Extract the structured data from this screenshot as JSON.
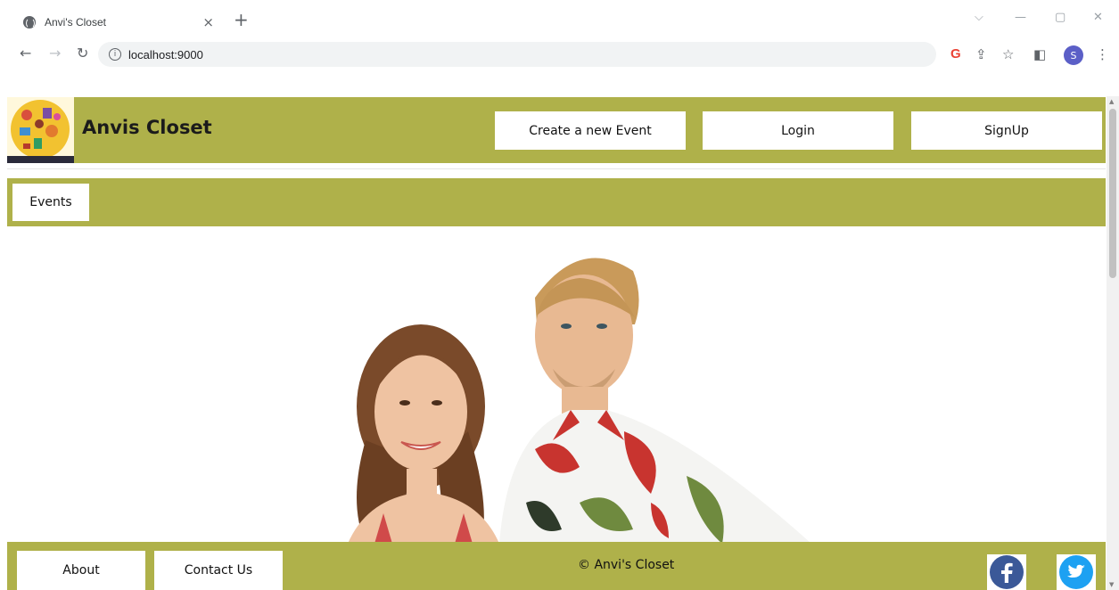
{
  "browser": {
    "tab_title": "Anvi's Closet",
    "tab_close": "×",
    "new_tab": "+",
    "url": "localhost:9000",
    "profile_initial": "S"
  },
  "header": {
    "brand": "Anvis Closet",
    "create_event_label": "Create a new Event",
    "login_label": "Login",
    "signup_label": "SignUp"
  },
  "subnav": {
    "events_label": "Events"
  },
  "footer": {
    "about_label": "About",
    "contact_label": "Contact Us",
    "copyright": "© Anvi's Closet"
  },
  "colors": {
    "accent": "#afb14a",
    "button_bg": "#ffffff",
    "facebook": "#3b5998",
    "twitter": "#1da1f2"
  },
  "icons": {
    "facebook": "facebook-icon",
    "twitter": "twitter-icon"
  }
}
